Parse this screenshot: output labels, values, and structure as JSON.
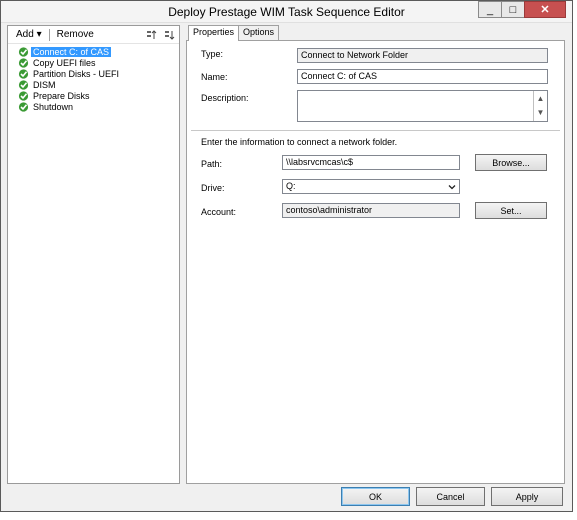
{
  "window": {
    "title": "Deploy Prestage WIM Task Sequence Editor"
  },
  "window_buttons": {
    "minimize": "_",
    "maximize": "□",
    "close": "✕"
  },
  "toolbar": {
    "add_label": "Add",
    "add_arrow": "▾",
    "remove_label": "Remove"
  },
  "tree": {
    "items": [
      {
        "label": "Connect C: of CAS",
        "selected": true
      },
      {
        "label": "Copy UEFI files"
      },
      {
        "label": "Partition Disks - UEFI"
      },
      {
        "label": "DISM"
      },
      {
        "label": "Prepare Disks"
      },
      {
        "label": "Shutdown"
      }
    ]
  },
  "tabs": [
    {
      "label": "Properties",
      "active": true
    },
    {
      "label": "Options"
    }
  ],
  "properties": {
    "type_label": "Type:",
    "type_value": "Connect to Network Folder",
    "name_label": "Name:",
    "name_value": "Connect C: of CAS",
    "description_label": "Description:",
    "description_value": "",
    "instructions": "Enter the information to connect a network folder.",
    "path_label": "Path:",
    "path_value": "\\\\labsrvcmcas\\c$",
    "browse_button": "Browse...",
    "drive_label": "Drive:",
    "drive_value": "Q:",
    "account_label": "Account:",
    "account_value": "contoso\\administrator",
    "set_button": "Set..."
  },
  "footer": {
    "ok": "OK",
    "cancel": "Cancel",
    "apply": "Apply"
  }
}
